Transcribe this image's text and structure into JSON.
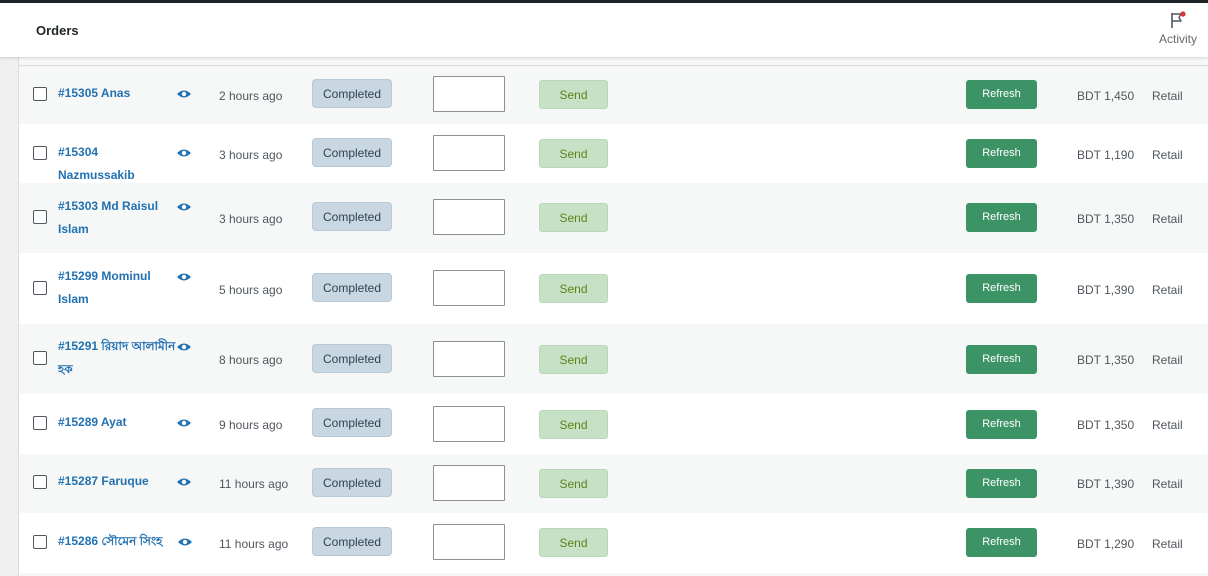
{
  "header": {
    "title": "Orders",
    "activity_label": "Activity"
  },
  "orders": [
    {
      "order": "#15305 Anas",
      "time": "2 hours ago",
      "status": "Completed",
      "send": "Send",
      "refresh": "Refresh",
      "total": "BDT 1,450",
      "type": "Retail"
    },
    {
      "order": "#15304 Nazmussakib",
      "time": "3 hours ago",
      "status": "Completed",
      "send": "Send",
      "refresh": "Refresh",
      "total": "BDT 1,190",
      "type": "Retail"
    },
    {
      "order": "#15303 Md Raisul Islam",
      "time": "3 hours ago",
      "status": "Completed",
      "send": "Send",
      "refresh": "Refresh",
      "total": "BDT 1,350",
      "type": "Retail"
    },
    {
      "order": "#15299 Mominul Islam",
      "time": "5 hours ago",
      "status": "Completed",
      "send": "Send",
      "refresh": "Refresh",
      "total": "BDT 1,390",
      "type": "Retail"
    },
    {
      "order": "#15291 রিয়াদ আলামীন হক",
      "time": "8 hours ago",
      "status": "Completed",
      "send": "Send",
      "refresh": "Refresh",
      "total": "BDT 1,350",
      "type": "Retail"
    },
    {
      "order": "#15289 Ayat",
      "time": "9 hours ago",
      "status": "Completed",
      "send": "Send",
      "refresh": "Refresh",
      "total": "BDT 1,350",
      "type": "Retail"
    },
    {
      "order": "#15287 Faruque",
      "time": "11 hours ago",
      "status": "Completed",
      "send": "Send",
      "refresh": "Refresh",
      "total": "BDT 1,390",
      "type": "Retail"
    },
    {
      "order": "#15286 সৌমেন সিংহ",
      "time": "11 hours ago",
      "status": "Completed",
      "send": "Send",
      "refresh": "Refresh",
      "total": "BDT 1,290",
      "type": "Retail"
    }
  ]
}
